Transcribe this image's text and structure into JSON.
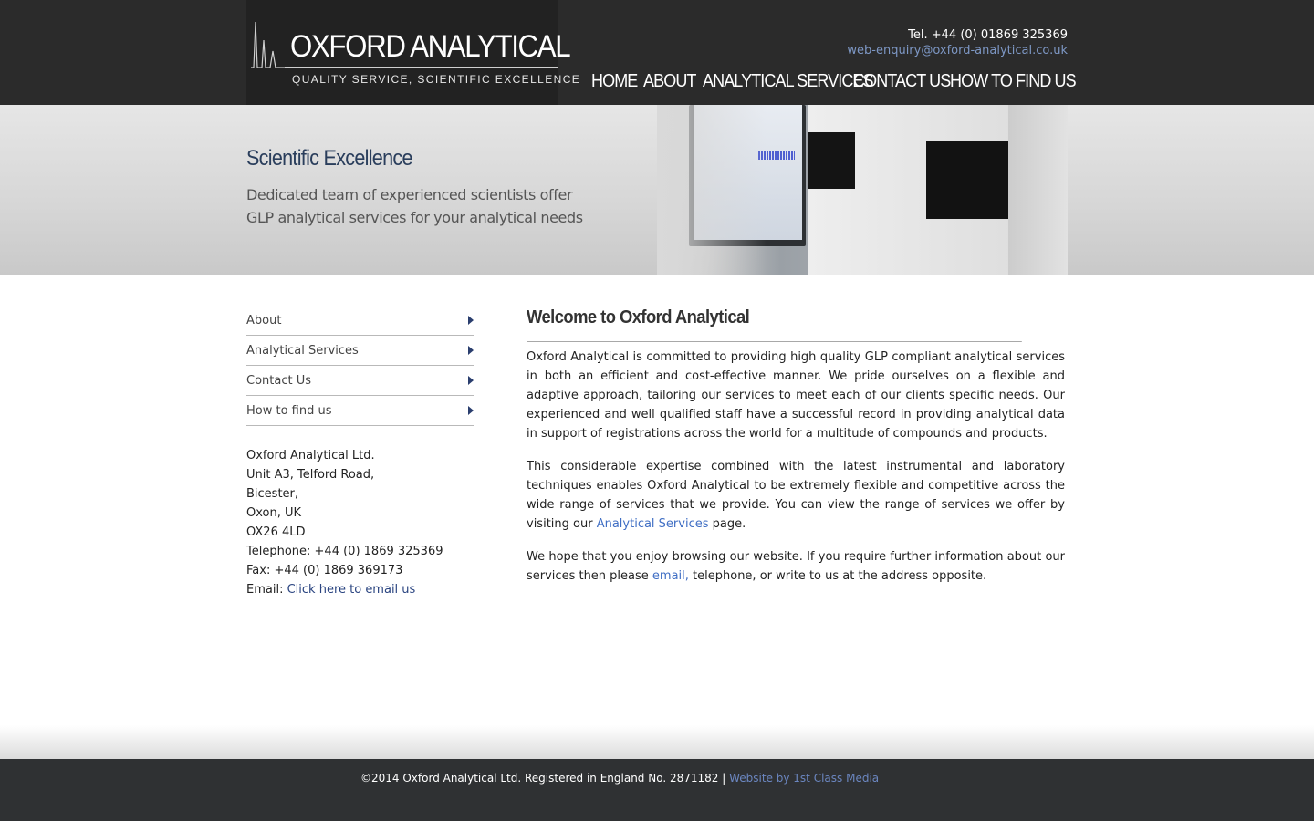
{
  "header": {
    "logo_name": "OXFORD ANALYTICAL",
    "logo_tagline": "QUALITY SERVICE, SCIENTIFIC EXCELLENCE",
    "tel": "Tel. +44 (0) 01869 325369",
    "email": "web-enquiry@oxford-analytical.co.uk"
  },
  "nav": {
    "items": [
      {
        "label": "HOME"
      },
      {
        "label": "ABOUT"
      },
      {
        "label": "ANALYTICAL SERVICES"
      },
      {
        "label": "CONTACT US"
      },
      {
        "label": "HOW TO FIND US"
      }
    ]
  },
  "banner": {
    "title": "Scientific Excellence",
    "line1": "Dedicated team of experienced scientists offer",
    "line2": "GLP analytical services for your analytical needs"
  },
  "sidebar": {
    "items": [
      {
        "label": "About"
      },
      {
        "label": "Analytical Services"
      },
      {
        "label": "Contact Us"
      },
      {
        "label": "How to find us"
      }
    ],
    "address": {
      "company": "Oxford Analytical Ltd.",
      "street": "Unit A3, Telford Road,",
      "town": "Bicester,",
      "county": "Oxon, UK",
      "postcode": "OX26 4LD",
      "telephone": "Telephone: +44 (0) 1869 325369",
      "fax": "Fax: +44 (0) 1869 369173",
      "email_label": "Email:",
      "email_link": "Click here to email us"
    }
  },
  "main": {
    "title": "Welcome to Oxford Analytical",
    "p1": "Oxford Analytical is committed to providing high quality GLP compliant analytical services in both an efficient and cost-effective manner. We pride ourselves on a flexible and adaptive approach, tailoring our services to meet each of our clients specific needs. Our experienced and well qualified staff have a successful record in providing analytical data in support of registrations across the world for a multitude of compounds and products.",
    "p2_before": "This considerable expertise combined with the latest instrumental and laboratory techniques enables Oxford Analytical to be extremely flexible and competitive across the wide range of services that we provide. You can view the range of services we offer by visiting our ",
    "p2_link": "Analytical Services",
    "p2_after": " page.",
    "p3_before": "We hope that you enjoy browsing our website. If you require further information about our services then please ",
    "p3_link": "email,",
    "p3_after": " telephone, or write to us at the address opposite."
  },
  "footer": {
    "copyright": "©2014 Oxford Analytical Ltd. Registered in England No. 2871182 |",
    "credit_link": "Website by 1st Class Media"
  },
  "colors": {
    "header_bg": "#2b2b2b",
    "accent_link": "#3f6ec4",
    "heading_navy": "#2a3e5c",
    "footer_bg": "#2f3133"
  }
}
